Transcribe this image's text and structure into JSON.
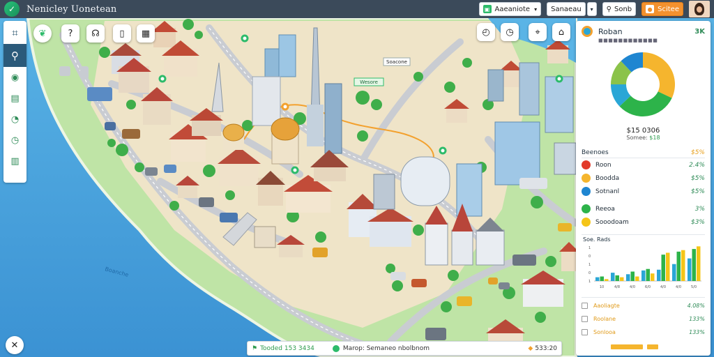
{
  "app": {
    "title": "Nenicley Uonetean"
  },
  "topbar": {
    "dropdown_label": "Aaeaniote",
    "view_label": "Sanaeau",
    "search_label": "Sonb",
    "action_label": "Scitee"
  },
  "colors": {
    "accent": "#2dbb6a",
    "orange": "#f3912e",
    "nav": "#3b4a5a",
    "water": "#4aa3df"
  },
  "panel": {
    "title": "Roban",
    "title_value": "3K",
    "subtitle": "■■■■■■■■■■■■",
    "donut": {
      "total": "$15 0306",
      "sub_label": "Somee:",
      "sub_value": "$18",
      "segments": [
        {
          "color": "#f5b52e",
          "value": 32
        },
        {
          "color": "#2db34a",
          "value": 31
        },
        {
          "color": "#2aa6d6",
          "value": 12
        },
        {
          "color": "#8bc34a",
          "value": 13
        },
        {
          "color": "#1f86d1",
          "value": 12
        }
      ]
    },
    "breakdown": {
      "header_label": "Beenoes",
      "header_value": "$5%",
      "rows": [
        {
          "label": "Roon",
          "value": "2.4%",
          "color": "#e23b2b",
          "icon": "dot"
        },
        {
          "label": "Boodda",
          "value": "$5%",
          "color": "#f5b52e",
          "icon": "dot"
        },
        {
          "label": "Sotnanl",
          "value": "$5%",
          "color": "#1f86d1",
          "icon": "dot"
        },
        {
          "label": "Reeoa",
          "value": "3%",
          "color": "#2db34a",
          "icon": "dot"
        },
        {
          "label": "Sooodoam",
          "value": "$3%",
          "color": "#f5c518",
          "icon": "dot"
        }
      ]
    },
    "bars": {
      "title": "Soe. Rads",
      "y_ticks": [
        "1",
        "0",
        "1",
        "0",
        "1"
      ],
      "x_ticks": [
        "10",
        "4/8",
        "4/0",
        "6/0",
        "4/0",
        "4/0",
        "5/0"
      ]
    },
    "stats": [
      {
        "label": "Aaoliagte",
        "value": "4.08%"
      },
      {
        "label": "Roolane",
        "value": "133%"
      },
      {
        "label": "Sonlooa",
        "value": "133%"
      }
    ]
  },
  "chart_data": {
    "type": "bar",
    "title": "Soe. Rads",
    "x": [
      "10",
      "4/8",
      "4/0",
      "6/0",
      "4/0",
      "4/0",
      "5/0"
    ],
    "series": [
      {
        "name": "",
        "color": "#2aa6d6",
        "values": [
          0.1,
          0.22,
          0.18,
          0.28,
          0.3,
          0.45,
          0.6
        ]
      },
      {
        "name": "",
        "color": "#2db34a",
        "values": [
          0.12,
          0.15,
          0.25,
          0.32,
          0.7,
          0.78,
          0.85
        ]
      },
      {
        "name": "",
        "color": "#f5c518",
        "values": [
          0.05,
          0.1,
          0.12,
          0.2,
          0.75,
          0.82,
          0.92
        ]
      }
    ],
    "ylim": [
      0,
      1
    ]
  },
  "status": {
    "left": "Tooded 153 3434",
    "mid": "Marop: Semaneo nbolbnom",
    "right": "533:20"
  },
  "map": {
    "labels": [
      "Soacone",
      "Wesore",
      "Boanche"
    ]
  }
}
